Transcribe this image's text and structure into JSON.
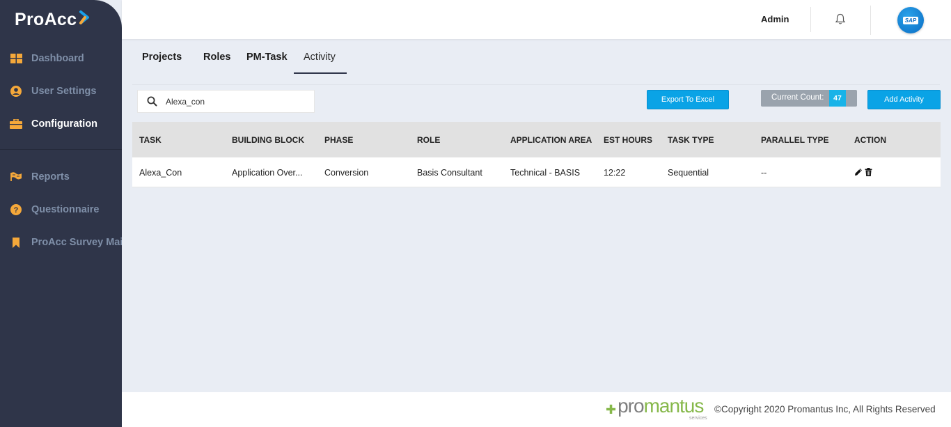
{
  "app": {
    "logo_text": "ProAcc"
  },
  "sidebar": {
    "items": [
      {
        "label": "Dashboard",
        "icon": "dashboard-grid-icon"
      },
      {
        "label": "User Settings",
        "icon": "user-circle-icon"
      },
      {
        "label": "Configuration",
        "icon": "briefcase-icon"
      },
      {
        "label": "Reports",
        "icon": "flag-icon"
      },
      {
        "label": "Questionnaire",
        "icon": "question-circle-icon"
      },
      {
        "label": "ProAcc Survey Mail",
        "icon": "bookmark-icon"
      }
    ],
    "active": "Configuration"
  },
  "header": {
    "user": "Admin",
    "notification_icon": "bell-icon",
    "avatar_text": "SAP"
  },
  "tabs": [
    {
      "label": "Projects"
    },
    {
      "label": "Roles"
    },
    {
      "label": "PM-Task"
    },
    {
      "label": "Activity"
    }
  ],
  "active_tab": "Activity",
  "search": {
    "value": "Alexa_con",
    "icon": "search-icon"
  },
  "toolbar": {
    "export_label": "Export To Excel",
    "count_label": "Current Count:",
    "count_value": "47",
    "add_label": "Add Activity"
  },
  "table": {
    "columns": [
      "TASK",
      "BUILDING BLOCK",
      "PHASE",
      "ROLE",
      "APPLICATION AREA",
      "EST HOURS",
      "TASK TYPE",
      "PARALLEL TYPE",
      "ACTION"
    ],
    "rows": [
      [
        "Alexa_Con",
        "Application Over...",
        "Conversion",
        "Basis Consultant",
        "Technical - BASIS",
        "12:22",
        "Sequential",
        "--"
      ]
    ],
    "row_actions": [
      "pencil-icon",
      "trash-icon"
    ]
  },
  "footer": {
    "brand_pro": "pro",
    "brand_mantus": "mantus",
    "brand_services": "services",
    "copyright": "©Copyright 2020 Promantus Inc, All Rights Reserved"
  },
  "colors": {
    "sidebar_bg": "#2f3549",
    "sidebar_icon": "#f5a83a",
    "primary_button": "#0aa3e6",
    "count_bg": "#9aa3ad",
    "count_value_bg": "#18b3e8",
    "brand_green": "#86b84a"
  }
}
